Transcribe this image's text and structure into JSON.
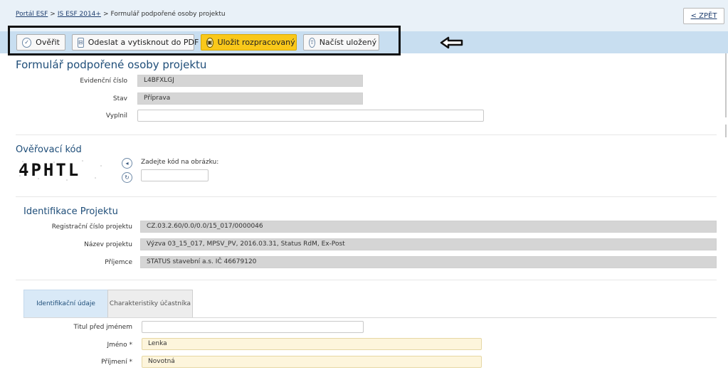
{
  "breadcrumb": {
    "items": [
      "Portál ESF",
      "IS ESF 2014+",
      "Formulář podpořené osoby projektu"
    ],
    "separator": ">"
  },
  "back_button": {
    "label": "< ZPĚT"
  },
  "toolbar": {
    "verify_label": "Ověřit",
    "send_print_label": "Odeslat a vytisknout do PDF",
    "save_label": "Uložit rozpracovaný",
    "load_label": "Načíst uložený"
  },
  "form": {
    "title": "Formulář podpořené osoby projektu",
    "fields": {
      "evidence_label": "Evidenční číslo",
      "evidence_value": "L4BFXLGJ",
      "status_label": "Stav",
      "status_value": "Příprava",
      "filled_by_label": "Vyplnil",
      "filled_by_value": ""
    }
  },
  "verification": {
    "title": "Ověřovací kód",
    "captcha_text": "4PHTL",
    "prompt": "Zadejte kód na obrázku:",
    "input_value": ""
  },
  "project": {
    "title": "Identifikace Projektu",
    "reg_label": "Registrační číslo projektu",
    "reg_value": "CZ.03.2.60/0.0/0.0/15_017/0000046",
    "name_label": "Název projektu",
    "name_value": "Výzva 03_15_017, MPSV_PV, 2016.03.31, Status RdM, Ex-Post",
    "recipient_label": "Příjemce",
    "recipient_value": "STATUS stavební a.s. IČ 46679120"
  },
  "tabs": {
    "identification": "Identifikační údaje",
    "characteristics": "Charakteristiky účastníka"
  },
  "person": {
    "title_before_label": "Titul před jménem",
    "title_before_value": "",
    "first_name_label": "Jméno *",
    "first_name_value": "Lenka",
    "last_name_label": "Příjmení *",
    "last_name_value": "Novotná"
  },
  "colors": {
    "accent": "#1f4e79",
    "toolbar": "#c8def0",
    "primary_button": "#f9c81a",
    "required_field": "#fdf5dc"
  }
}
